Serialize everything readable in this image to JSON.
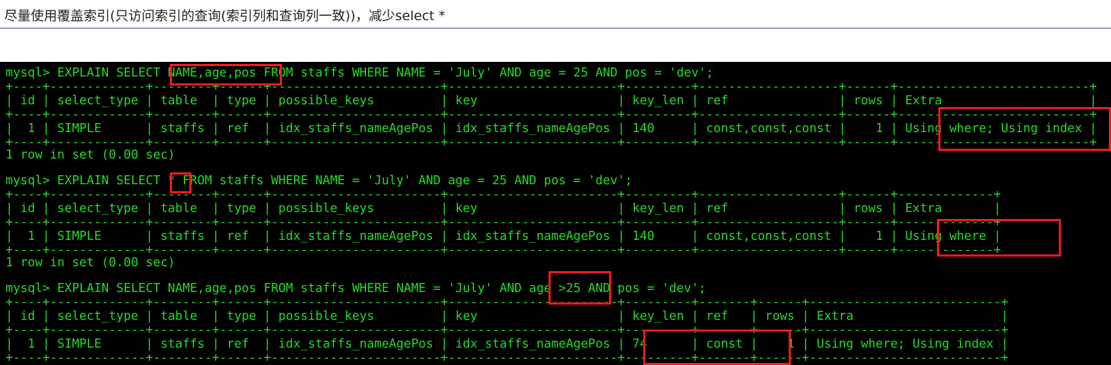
{
  "caption": "尽量使用覆盖索引(只访问索引的查询(索引列和查询列一致))，减少select *",
  "terminal": {
    "lines": [
      "mysql> EXPLAIN SELECT NAME,age,pos FROM staffs WHERE NAME = 'July' AND age = 25 AND pos = 'dev';",
      "+----+-------------+--------+------+-----------------------+-----------------------+---------+-------------------+------+--------------------------+",
      "| id | select_type | table  | type | possible_keys         | key                   | key_len | ref               | rows | Extra                    |",
      "+----+-------------+--------+------+-----------------------+-----------------------+---------+-------------------+------+--------------------------+",
      "|  1 | SIMPLE      | staffs | ref  | idx_staffs_nameAgePos | idx_staffs_nameAgePos | 140     | const,const,const |    1 | Using where; Using index |",
      "+----+-------------+--------+------+-----------------------+-----------------------+---------+-------------------+------+--------------------------+",
      "1 row in set (0.00 sec)",
      "mysql> EXPLAIN SELECT * FROM staffs WHERE NAME = 'July' AND age = 25 AND pos = 'dev';",
      "+----+-------------+--------+------+-----------------------+-----------------------+---------+-------------------+------+-------------+",
      "| id | select_type | table  | type | possible_keys         | key                   | key_len | ref               | rows | Extra       |",
      "+----+-------------+--------+------+-----------------------+-----------------------+---------+-------------------+------+-------------+",
      "|  1 | SIMPLE      | staffs | ref  | idx_staffs_nameAgePos | idx_staffs_nameAgePos | 140     | const,const,const |    1 | Using where |",
      "+----+-------------+--------+------+-----------------------+-----------------------+---------+-------------------+------+-------------+",
      "1 row in set (0.00 sec)",
      "mysql> EXPLAIN SELECT NAME,age,pos FROM staffs WHERE NAME = 'July' AND age >25 AND pos = 'dev';",
      "+----+-------------+--------+------+-----------------------+-----------------------+---------+-------+------+--------------------------+",
      "| id | select_type | table  | type | possible_keys         | key                   | key_len | ref   | rows | Extra                    |",
      "+----+-------------+--------+------+-----------------------+-----------------------+---------+-------+------+--------------------------+",
      "|  1 | SIMPLE      | staffs | ref  | idx_staffs_nameAgePos | idx_staffs_nameAgePos | 74      | const |    1 | Using where; Using index |",
      "+----+-------------+--------+------+-----------------------+-----------------------+---------+-------+------+--------------------------+"
    ]
  },
  "colors": {
    "terminal_text": "#22dd22",
    "terminal_bg": "#000000",
    "highlight": "#ff1a1a"
  }
}
